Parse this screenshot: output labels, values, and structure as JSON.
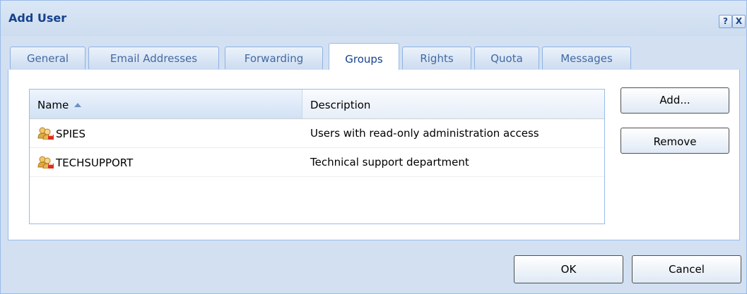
{
  "dialog": {
    "title": "Add User",
    "help_icon_glyph": "?",
    "close_icon_glyph": "X"
  },
  "tabs": [
    {
      "label": "General"
    },
    {
      "label": "Email Addresses"
    },
    {
      "label": "Forwarding"
    },
    {
      "label": "Groups",
      "active": true
    },
    {
      "label": "Rights"
    },
    {
      "label": "Quota"
    },
    {
      "label": "Messages"
    }
  ],
  "grid": {
    "columns": [
      {
        "label": "Name",
        "sort": "ascending"
      },
      {
        "label": "Description"
      }
    ],
    "rows": [
      {
        "icon": "user-group-icon",
        "name": "SPIES",
        "description": "Users with read-only administration access"
      },
      {
        "icon": "user-group-icon",
        "name": "TECHSUPPORT",
        "description": "Technical support department"
      }
    ]
  },
  "side_buttons": {
    "add_label": "Add...",
    "remove_label": "Remove"
  },
  "footer": {
    "ok_label": "OK",
    "cancel_label": "Cancel"
  },
  "colors": {
    "title_text": "#15428b",
    "frame_border": "#99bbe8",
    "frame_bg": "#d2e0f2"
  }
}
